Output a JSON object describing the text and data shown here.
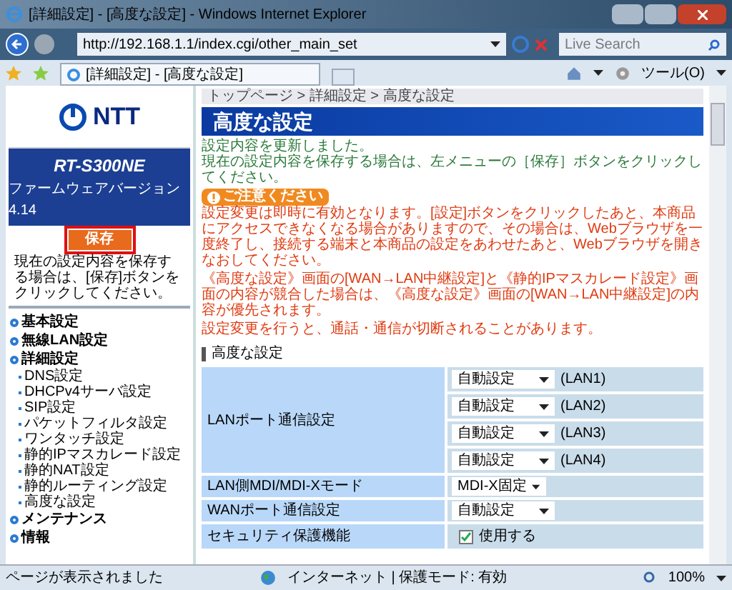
{
  "window": {
    "title": "[詳細設定] - [高度な設定] - Windows Internet Explorer"
  },
  "nav": {
    "address": "http://192.168.1.1/index.cgi/other_main_set",
    "search_placeholder": "Live Search"
  },
  "tab": {
    "title": "[詳細設定] - [高度な設定]"
  },
  "toolbar": {
    "tools": "ツール(O)"
  },
  "sidebar": {
    "logo": "NTT",
    "model": "RT-S300NE",
    "firmware": "ファームウェアバージョン 4.14",
    "save_button": "保存",
    "save_note": "現在の設定内容を保存する場合は、[保存]ボタンをクリックしてください。",
    "menu": [
      {
        "label": "基本設定"
      },
      {
        "label": "無線LAN設定"
      },
      {
        "label": "詳細設定",
        "children": [
          "DNS設定",
          "DHCPv4サーバ設定",
          "SIP設定",
          "パケットフィルタ設定",
          "ワンタッチ設定",
          "静的IPマスカレード設定",
          "静的NAT設定",
          "静的ルーティング設定",
          "高度な設定"
        ]
      },
      {
        "label": "メンテナンス"
      },
      {
        "label": "情報"
      }
    ]
  },
  "breadcrumb": "トップページ > 詳細設定 > 高度な設定",
  "page_title": "高度な設定",
  "notice": [
    "設定内容を更新しました。",
    "現在の設定内容を保存する場合は、左メニューの［保存］ボタンをクリックしてください。"
  ],
  "caution_label": "ご注意ください",
  "warnings": [
    "設定変更は即時に有効となります。[設定]ボタンをクリックしたあと、本商品にアクセスできなくなる場合がありますので、その場合は、Webブラウザを一度終了し、接続する端末と本商品の設定をあわせたあと、Webブラウザを開きなおしてください。",
    "《高度な設定》画面の[WAN→LAN中継設定]と《静的IPマスカレード設定》画面の内容が競合した場合は、《高度な設定》画面の[WAN→LAN中継設定]の内容が優先されます。",
    "設定変更を行うと、通話・通信が切断されることがあります。"
  ],
  "section_heading": "高度な設定",
  "rows": [
    {
      "label": "LANポート通信設定",
      "kind": "selects",
      "selects": [
        {
          "value": "自動設定",
          "suffix": "(LAN1)"
        },
        {
          "value": "自動設定",
          "suffix": "(LAN2)"
        },
        {
          "value": "自動設定",
          "suffix": "(LAN3)"
        },
        {
          "value": "自動設定",
          "suffix": "(LAN4)"
        }
      ]
    },
    {
      "label": "LAN側MDI/MDI-Xモード",
      "kind": "selects",
      "selects": [
        {
          "value": "MDI-X固定"
        }
      ]
    },
    {
      "label": "WANポート通信設定",
      "kind": "selects",
      "selects": [
        {
          "value": "自動設定"
        }
      ]
    },
    {
      "label": "セキュリティ保護機能",
      "kind": "checkbox",
      "text": "使用する",
      "checked": true
    }
  ],
  "status_bar": {
    "text": "ページが表示されました",
    "zone": "インターネット | 保護モード: 有効",
    "zoom": "100%"
  }
}
